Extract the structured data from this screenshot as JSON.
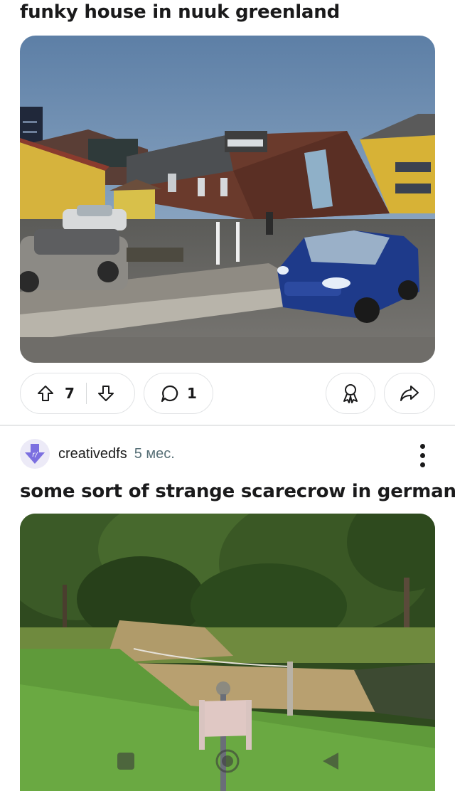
{
  "posts": [
    {
      "title": "funky house in nuuk greenland",
      "actions": {
        "upvotes": "7",
        "comments": "1"
      },
      "icons": {
        "upvote": "upvote-arrow-icon",
        "downvote": "downvote-arrow-icon",
        "comment": "comment-bubble-icon",
        "award": "award-icon",
        "share": "share-arrow-icon"
      }
    },
    {
      "author": "creativedfs",
      "age": "5 мес.",
      "title": "some sort of strange scarecrow in germany",
      "icons": {
        "avatar": "reddit-avatar-icon",
        "more": "more-options-icon"
      }
    }
  ],
  "system_nav": {
    "icons": [
      "recent-apps-icon",
      "home-icon",
      "back-icon"
    ]
  },
  "colors": {
    "pill_border": "#e1e3e5",
    "text_primary": "#1a1a1b",
    "text_secondary": "#576f76",
    "avatar_accent": "#7b6fe0"
  }
}
